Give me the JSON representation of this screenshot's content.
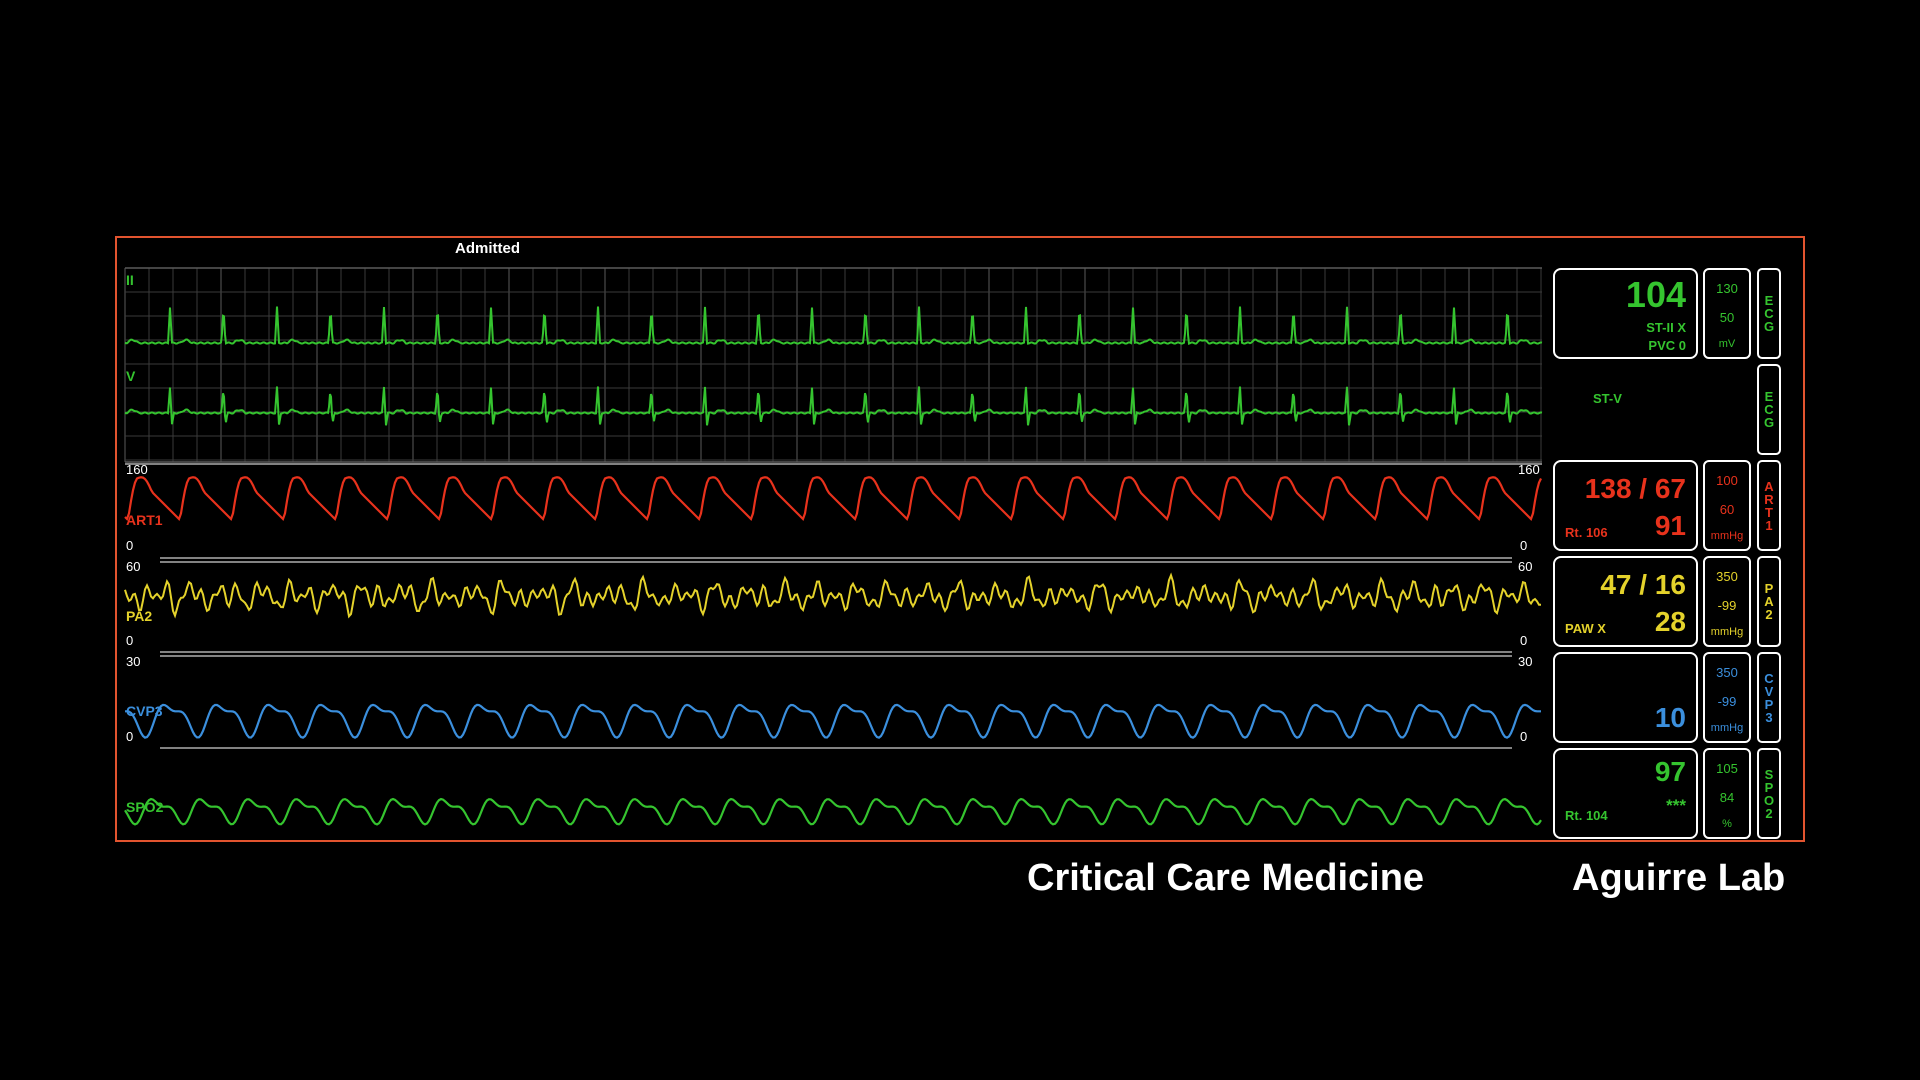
{
  "monitor": {
    "status": "Admitted"
  },
  "colors": {
    "ecg": "#35c42f",
    "art": "#e8321c",
    "pa": "#e4d22b",
    "cvp": "#3b8fdd",
    "spo2": "#35c42f",
    "frame": "#e2542f"
  },
  "waves": {
    "ecg_ii": {
      "label": "II"
    },
    "ecg_v": {
      "label": "V"
    },
    "art": {
      "label": "ART1",
      "scale_top": "160",
      "scale_bottom": "0"
    },
    "pa": {
      "label": "PA2",
      "scale_top": "60",
      "scale_bottom": "0"
    },
    "cvp": {
      "label": "CVP3",
      "scale_top": "30",
      "scale_bottom": "0"
    },
    "spo2": {
      "label": "SPO2"
    }
  },
  "panels": {
    "ecg": {
      "value": "104",
      "line1": "ST-II  X",
      "line2": "PVC 0",
      "limits": [
        "130",
        "50",
        "mV"
      ],
      "tag": "ECG"
    },
    "ecg2": {
      "label": "ST-V",
      "tag": "ECG"
    },
    "art": {
      "value": "138 / 67",
      "mean": "91",
      "rate": "Rt. 106",
      "limits": [
        "100",
        "60",
        "mmHg"
      ],
      "tag": "ART1"
    },
    "pa": {
      "value": "47 / 16",
      "mean": "28",
      "paw": "PAW X",
      "limits": [
        "350",
        "-99",
        "mmHg"
      ],
      "tag": "PA2"
    },
    "cvp": {
      "mean": "10",
      "limits": [
        "350",
        "-99",
        "mmHg"
      ],
      "tag": "CVP3"
    },
    "spo2": {
      "value": "97",
      "stars": "***",
      "rate": "Rt. 104",
      "limits": [
        "105",
        "84",
        "%"
      ],
      "tag": "SPO2"
    }
  },
  "footer": {
    "left": "Critical Care Medicine",
    "right": "Aguirre Lab"
  }
}
